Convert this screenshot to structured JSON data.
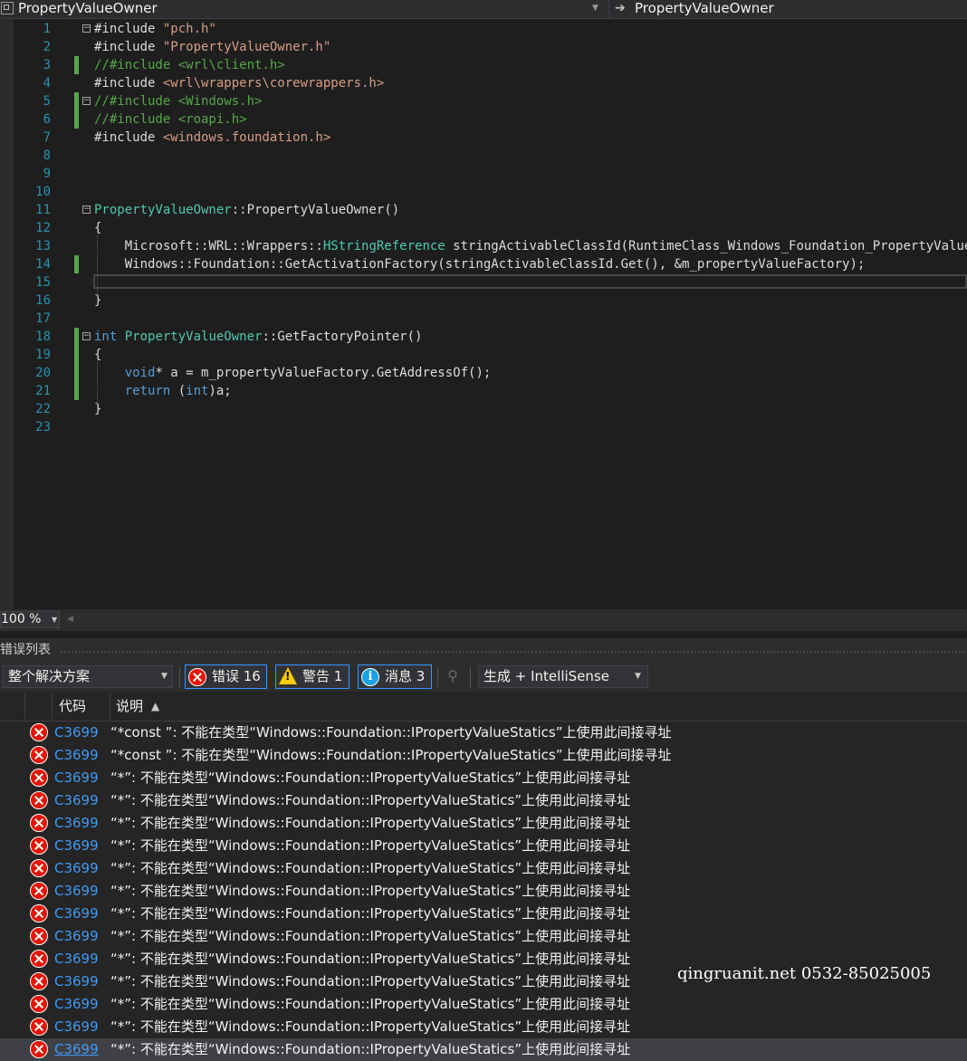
{
  "navbar": {
    "left_label": "PropertyValueOwner",
    "right_label": "PropertyValueOwner",
    "arrow": "➔"
  },
  "editor": {
    "lines": [
      {
        "num": "1",
        "segments": [
          [
            "",
            "#include "
          ],
          [
            "str",
            "\"pch.h\""
          ]
        ]
      },
      {
        "num": "2",
        "segments": [
          [
            "",
            "#include "
          ],
          [
            "str",
            "\"PropertyValueOwner.h\""
          ]
        ]
      },
      {
        "num": "3",
        "segments": [
          [
            "cmt",
            "//#include <wrl\\client.h>"
          ]
        ]
      },
      {
        "num": "4",
        "segments": [
          [
            "",
            "#include "
          ],
          [
            "str",
            "<wrl\\wrappers\\corewrappers.h>"
          ]
        ]
      },
      {
        "num": "5",
        "segments": [
          [
            "cmt",
            "//#include <Windows.h>"
          ]
        ]
      },
      {
        "num": "6",
        "segments": [
          [
            "cmt",
            "//#include <roapi.h>"
          ]
        ]
      },
      {
        "num": "7",
        "segments": [
          [
            "",
            "#include "
          ],
          [
            "str",
            "<windows.foundation.h>"
          ]
        ]
      },
      {
        "num": "8",
        "segments": []
      },
      {
        "num": "9",
        "segments": []
      },
      {
        "num": "10",
        "segments": []
      },
      {
        "num": "11",
        "segments": [
          [
            "typ",
            "PropertyValueOwner"
          ],
          [
            "",
            "::PropertyValueOwner()"
          ]
        ]
      },
      {
        "num": "12",
        "segments": [
          [
            "",
            "{"
          ]
        ]
      },
      {
        "num": "13",
        "segments": [
          [
            "",
            "    Microsoft::WRL::Wrappers::"
          ],
          [
            "typ",
            "HStringReference"
          ],
          [
            "",
            " stringActivableClassId(RuntimeClass_Windows_Foundation_PropertyValue);"
          ]
        ]
      },
      {
        "num": "14",
        "segments": [
          [
            "",
            "    Windows::Foundation::GetActivationFactory(stringActivableClassId.Get(), &m_propertyValueFactory);"
          ]
        ]
      },
      {
        "num": "15",
        "segments": []
      },
      {
        "num": "16",
        "segments": [
          [
            "",
            "}"
          ]
        ]
      },
      {
        "num": "17",
        "segments": []
      },
      {
        "num": "18",
        "segments": [
          [
            "kw",
            "int"
          ],
          [
            "",
            " "
          ],
          [
            "typ",
            "PropertyValueOwner"
          ],
          [
            "",
            "::GetFactoryPointer()"
          ]
        ]
      },
      {
        "num": "19",
        "segments": [
          [
            "",
            "{"
          ]
        ]
      },
      {
        "num": "20",
        "segments": [
          [
            "",
            "    "
          ],
          [
            "kw",
            "void"
          ],
          [
            "",
            "* a = m_propertyValueFactory.GetAddressOf();"
          ]
        ]
      },
      {
        "num": "21",
        "segments": [
          [
            "",
            "    "
          ],
          [
            "kw",
            "return"
          ],
          [
            "",
            " ("
          ],
          [
            "kw",
            "int"
          ],
          [
            "",
            ")a;"
          ]
        ]
      },
      {
        "num": "22",
        "segments": [
          [
            "",
            "}"
          ]
        ]
      },
      {
        "num": "23",
        "segments": []
      }
    ],
    "changed_lines": [
      3,
      5,
      6,
      14,
      18,
      19,
      20,
      21
    ],
    "fold_lines": [
      1,
      5,
      11,
      18
    ]
  },
  "zoom": {
    "level": "100 %"
  },
  "error_list": {
    "title": "错误列表",
    "scope": "整个解决方案",
    "errors_label": "错误 16",
    "warnings_label": "警告 1",
    "messages_label": "消息 3",
    "source": "生成 + IntelliSense",
    "col_code": "代码",
    "col_desc": "说明",
    "rows": [
      {
        "code": "C3699",
        "desc": "“*const ”: 不能在类型“Windows::Foundation::IPropertyValueStatics”上使用此间接寻址"
      },
      {
        "code": "C3699",
        "desc": "“*const ”: 不能在类型“Windows::Foundation::IPropertyValueStatics”上使用此间接寻址"
      },
      {
        "code": "C3699",
        "desc": "“*”: 不能在类型“Windows::Foundation::IPropertyValueStatics”上使用此间接寻址"
      },
      {
        "code": "C3699",
        "desc": "“*”: 不能在类型“Windows::Foundation::IPropertyValueStatics”上使用此间接寻址"
      },
      {
        "code": "C3699",
        "desc": "“*”: 不能在类型“Windows::Foundation::IPropertyValueStatics”上使用此间接寻址"
      },
      {
        "code": "C3699",
        "desc": "“*”: 不能在类型“Windows::Foundation::IPropertyValueStatics”上使用此间接寻址"
      },
      {
        "code": "C3699",
        "desc": "“*”: 不能在类型“Windows::Foundation::IPropertyValueStatics”上使用此间接寻址"
      },
      {
        "code": "C3699",
        "desc": "“*”: 不能在类型“Windows::Foundation::IPropertyValueStatics”上使用此间接寻址"
      },
      {
        "code": "C3699",
        "desc": "“*”: 不能在类型“Windows::Foundation::IPropertyValueStatics”上使用此间接寻址"
      },
      {
        "code": "C3699",
        "desc": "“*”: 不能在类型“Windows::Foundation::IPropertyValueStatics”上使用此间接寻址"
      },
      {
        "code": "C3699",
        "desc": "“*”: 不能在类型“Windows::Foundation::IPropertyValueStatics”上使用此间接寻址"
      },
      {
        "code": "C3699",
        "desc": "“*”: 不能在类型“Windows::Foundation::IPropertyValueStatics”上使用此间接寻址"
      },
      {
        "code": "C3699",
        "desc": "“*”: 不能在类型“Windows::Foundation::IPropertyValueStatics”上使用此间接寻址"
      },
      {
        "code": "C3699",
        "desc": "“*”: 不能在类型“Windows::Foundation::IPropertyValueStatics”上使用此间接寻址"
      },
      {
        "code": "C3699",
        "desc": "“*”: 不能在类型“Windows::Foundation::IPropertyValueStatics”上使用此间接寻址"
      }
    ],
    "selected_row": 14
  },
  "watermark": "qingruanit.net 0532-85025005"
}
